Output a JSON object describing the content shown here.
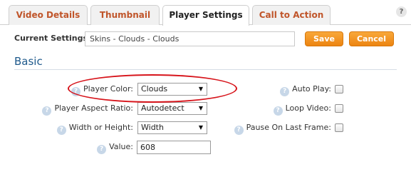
{
  "tabs": [
    {
      "label": "Video Details",
      "active": false
    },
    {
      "label": "Thumbnail",
      "active": false
    },
    {
      "label": "Player Settings",
      "active": true
    },
    {
      "label": "Call to Action",
      "active": false
    }
  ],
  "help_glyph": "?",
  "current_settings": {
    "label": "Current Settings:",
    "value": "Skins - Clouds - Clouds"
  },
  "buttons": {
    "save": "Save",
    "cancel": "Cancel"
  },
  "section": {
    "title": "Basic"
  },
  "fields": {
    "player_color": {
      "label": "Player Color:",
      "value": "Clouds"
    },
    "aspect_ratio": {
      "label": "Player Aspect Ratio:",
      "value": "Autodetect"
    },
    "width_or_height": {
      "label": "Width or Height:",
      "value": "Width"
    },
    "value": {
      "label": "Value:",
      "value": "608"
    }
  },
  "options": {
    "auto_play": {
      "label": "Auto Play:",
      "checked": false
    },
    "loop_video": {
      "label": "Loop Video:",
      "checked": false
    },
    "pause_on_last_frame": {
      "label": "Pause On Last Frame:",
      "checked": false
    }
  },
  "colors": {
    "accent_orange": "#ec8411",
    "tab_text": "#c0552a",
    "section_title": "#1f5a8c",
    "highlight": "#d7141b"
  }
}
